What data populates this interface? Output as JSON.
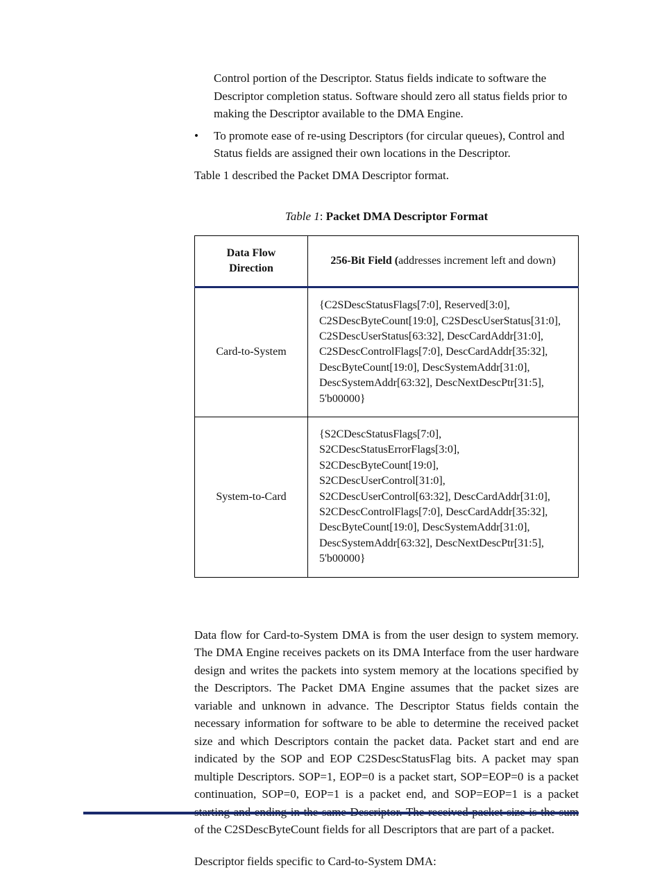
{
  "intro_continuation": "Control portion of the Descriptor. Status fields indicate to software the Descriptor completion status. Software should zero all status fields prior to making the Descriptor available to the DMA Engine.",
  "bullet_reuse": "To promote ease of re-using Descriptors (for circular queues), Control and Status fields are assigned their own locations in the Descriptor.",
  "table_ref": "Table 1 described the Packet DMA Descriptor format.",
  "table_caption_label": "Table 1",
  "table_caption_title": "Packet DMA Descriptor Format",
  "table": {
    "headers": {
      "col1": "Data Flow Direction",
      "col2_bold": "256-Bit Field (",
      "col2_rest": "addresses increment left and down)"
    },
    "rows": [
      {
        "direction": "Card-to-System",
        "fields": "{C2SDescStatusFlags[7:0], Reserved[3:0], C2SDescByteCount[19:0], C2SDescUserStatus[31:0], C2SDescUserStatus[63:32], DescCardAddr[31:0], C2SDescControlFlags[7:0], DescCardAddr[35:32], DescByteCount[19:0], DescSystemAddr[31:0], DescSystemAddr[63:32], DescNextDescPtr[31:5], 5'b00000}"
      },
      {
        "direction": "System-to-Card",
        "fields": "{S2CDescStatusFlags[7:0], S2CDescStatusErrorFlags[3:0], S2CDescByteCount[19:0], S2CDescUserControl[31:0], S2CDescUserControl[63:32], DescCardAddr[31:0], S2CDescControlFlags[7:0], DescCardAddr[35:32], DescByteCount[19:0], DescSystemAddr[31:0], DescSystemAddr[63:32], DescNextDescPtr[31:5], 5'b00000}"
      }
    ]
  },
  "body_para": "Data flow for Card-to-System DMA is from the user design to system memory. The DMA Engine receives packets on its DMA Interface from the user hardware design and writes the packets into system memory at the locations specified by the Descriptors. The Packet DMA Engine assumes that the packet sizes are variable and unknown in advance. The Descriptor Status fields contain the necessary information for software to be able to determine the received packet size and which Descriptors contain the packet data. Packet start and end are indicated by the SOP and EOP C2SDescStatusFlag bits. A packet may span multiple Descriptors. SOP=1, EOP=0 is a packet start, SOP=EOP=0 is a packet continuation, SOP=0, EOP=1 is a packet end, and SOP=EOP=1 is a packet starting and ending in the same Descriptor. The received packet size is the sum of the C2SDescByteCount fields for all Descriptors that are part of a packet.",
  "body_para2": "Descriptor fields specific to Card-to-System DMA:"
}
